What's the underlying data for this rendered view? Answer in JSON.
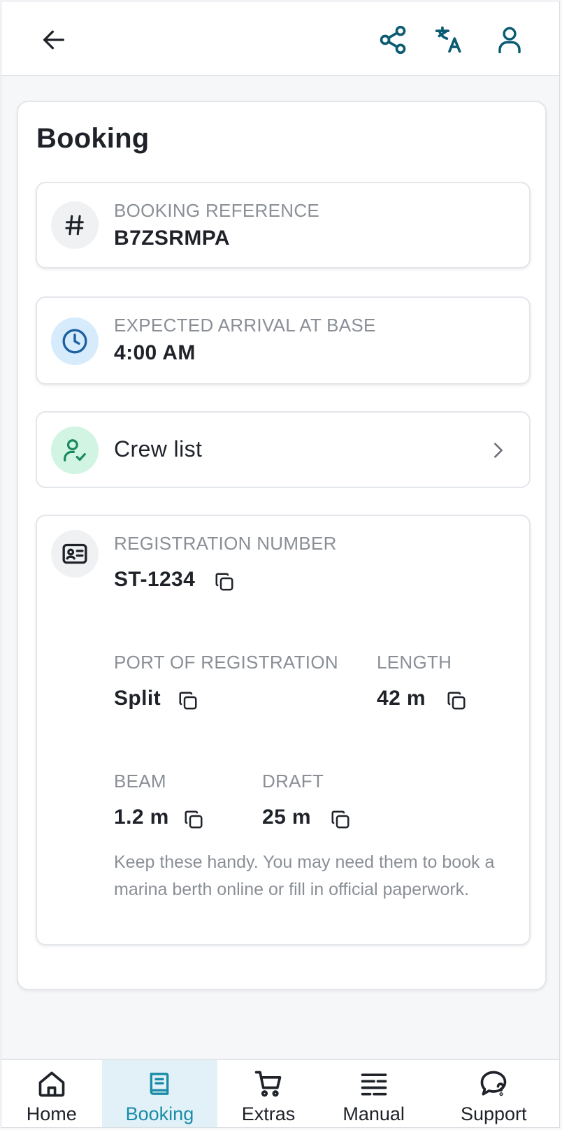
{
  "header": {
    "back_icon": "arrow-left-icon",
    "share_icon": "share-icon",
    "translate_icon": "translate-icon",
    "profile_icon": "user-icon",
    "accent_color": "#0b5c73"
  },
  "page": {
    "title": "Booking"
  },
  "booking_reference": {
    "label": "BOOKING REFERENCE",
    "value": "B7ZSRMPA",
    "icon": "hash-icon"
  },
  "arrival": {
    "label": "EXPECTED ARRIVAL AT BASE",
    "value": "4:00 AM",
    "icon": "clock-icon"
  },
  "crew": {
    "label": "Crew list",
    "icon": "user-check-icon"
  },
  "registration": {
    "icon": "id-card-icon",
    "number_label": "REGISTRATION NUMBER",
    "number_value": "ST-1234",
    "port_label": "PORT OF REGISTRATION",
    "port_value": "Split",
    "length_label": "LENGTH",
    "length_value": "42 m",
    "beam_label": "BEAM",
    "beam_value": "1.2 m",
    "draft_label": "DRAFT",
    "draft_value": "25 m",
    "note": "Keep these handy. You may need them to book a marina berth online or fill in official paperwork."
  },
  "nav": {
    "items": [
      {
        "label": "Home",
        "icon": "home-icon"
      },
      {
        "label": "Booking",
        "icon": "book-icon",
        "active": true
      },
      {
        "label": "Extras",
        "icon": "cart-icon"
      },
      {
        "label": "Manual",
        "icon": "list-icon"
      },
      {
        "label": "Support",
        "icon": "support-chat-icon"
      }
    ],
    "active_color": "#1a8ca8",
    "active_bg": "#e2f1f7"
  }
}
